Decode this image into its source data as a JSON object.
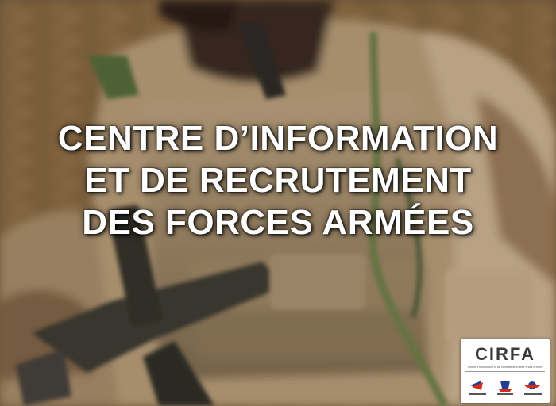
{
  "headline": {
    "line1": "CENTRE D’INFORMATION",
    "line2": "ET DE RECRUTEMENT",
    "line3": "DES FORCES ARMÉES"
  },
  "logo": {
    "title": "CIRFA",
    "subtitle": "Centre d'Information et de Recrutement des Forces Armées"
  },
  "colors": {
    "text": "#ffffff",
    "brick": "#8a6a45",
    "uniform": "#b69c78",
    "gear_dark": "#3c3a33"
  }
}
